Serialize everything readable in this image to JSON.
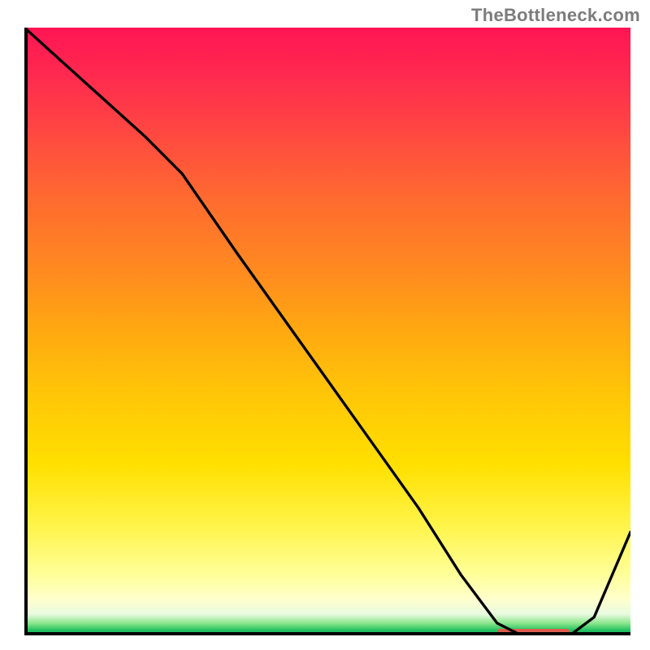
{
  "attribution": "TheBottleneck.com",
  "colors": {
    "gradient_top": "#ff1553",
    "gradient_mid": "#ffe000",
    "gradient_green": "#20c060",
    "curve": "#000000",
    "axis": "#000000",
    "marker": "#ff4a4a",
    "attribution_text": "#7c7c7c"
  },
  "chart_data": {
    "type": "line",
    "title": "",
    "xlabel": "",
    "ylabel": "",
    "xlim": [
      0,
      100
    ],
    "ylim": [
      0,
      100
    ],
    "grid": false,
    "legend": false,
    "x": [
      0,
      10,
      20,
      26,
      35,
      45,
      55,
      65,
      72,
      78,
      82,
      86,
      90,
      94,
      100
    ],
    "values": [
      100,
      91,
      82,
      76,
      63,
      49,
      35,
      21,
      10,
      2,
      0,
      0,
      0,
      3,
      17
    ],
    "marker_band": {
      "x_start": 78,
      "x_end": 90,
      "y": 0
    },
    "annotations": []
  }
}
